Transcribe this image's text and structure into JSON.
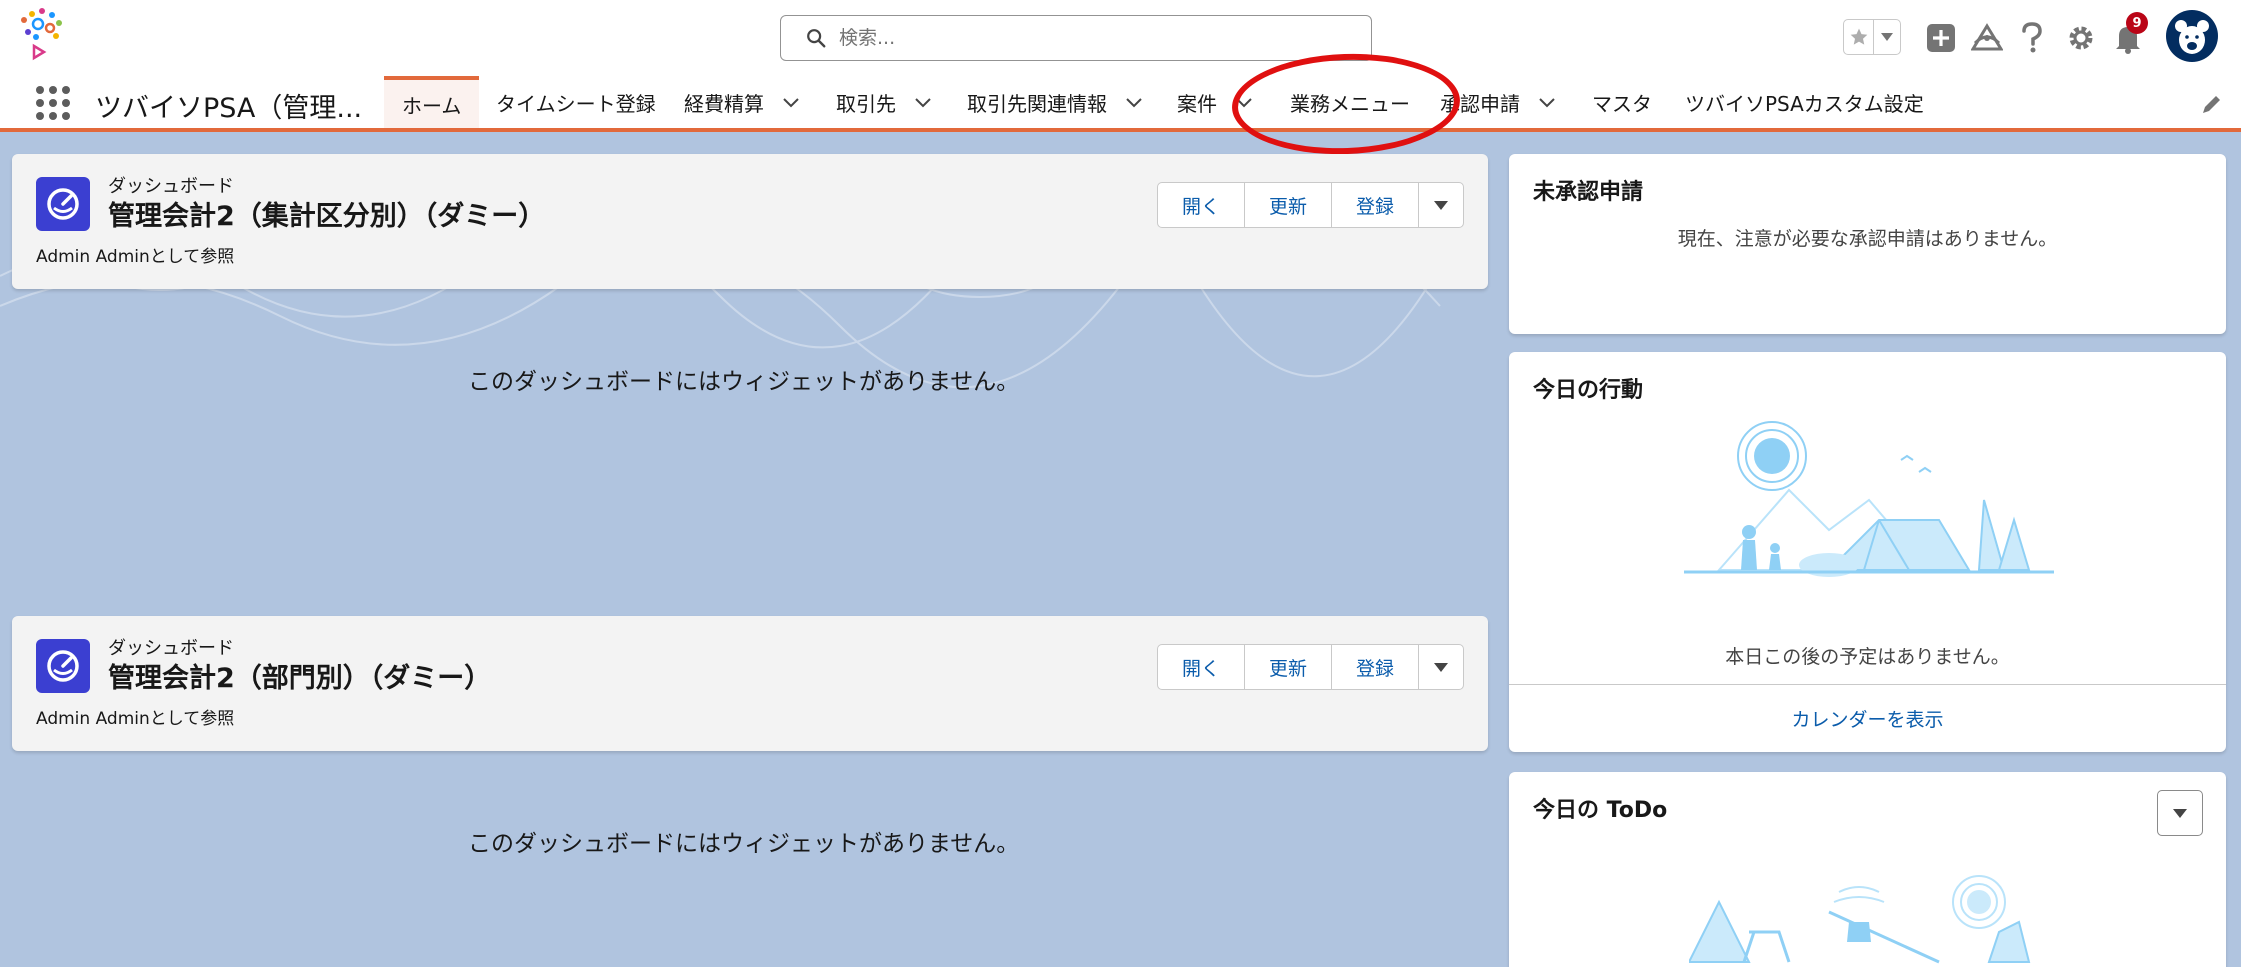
{
  "header": {
    "search_placeholder": "検索...",
    "notification_count": "9",
    "icons": [
      "favorites-star-icon",
      "add-icon",
      "trailhead-icon",
      "help-icon",
      "setup-gear-icon",
      "notification-bell-icon",
      "user-avatar"
    ]
  },
  "nav": {
    "app_name": "ツバイソPSA（管理...",
    "tabs": [
      {
        "label": "ホーム",
        "has_menu": false,
        "active": true
      },
      {
        "label": "タイムシート登録",
        "has_menu": false
      },
      {
        "label": "経費精算",
        "has_menu": true
      },
      {
        "label": "取引先",
        "has_menu": true
      },
      {
        "label": "取引先関連情報",
        "has_menu": true
      },
      {
        "label": "案件",
        "has_menu": true
      },
      {
        "label": "業務メニュー",
        "has_menu": false
      },
      {
        "label": "承認申請",
        "has_menu": true
      },
      {
        "label": "マスタ",
        "has_menu": false
      },
      {
        "label": "ツバイソPSAカスタム設定",
        "has_menu": false
      }
    ]
  },
  "dashboards": [
    {
      "type_label": "ダッシュボード",
      "title": "管理会計2（集計区分別）（ダミー）",
      "viewed_as": "Admin Adminとして参照",
      "buttons": {
        "open": "開く",
        "refresh": "更新",
        "subscribe": "登録"
      },
      "empty_message": "このダッシュボードにはウィジェットがありません。"
    },
    {
      "type_label": "ダッシュボード",
      "title": "管理会計2（部門別）（ダミー）",
      "viewed_as": "Admin Adminとして参照",
      "buttons": {
        "open": "開く",
        "refresh": "更新",
        "subscribe": "登録"
      },
      "empty_message": "このダッシュボードにはウィジェットがありません。"
    }
  ],
  "approvals": {
    "title": "未承認申請",
    "message": "現在、注意が必要な承認申請はありません。"
  },
  "today_events": {
    "title": "今日の行動",
    "message": "本日この後の予定はありません。",
    "link": "カレンダーを表示"
  },
  "today_todo": {
    "title": "今日の ToDo"
  },
  "colors": {
    "accent_orange": "#e2693b",
    "brand_blue": "#0b5cab",
    "dashboard_icon": "#3b3fd1",
    "page_background": "#b0c4df",
    "annotation_red": "#e01010"
  }
}
